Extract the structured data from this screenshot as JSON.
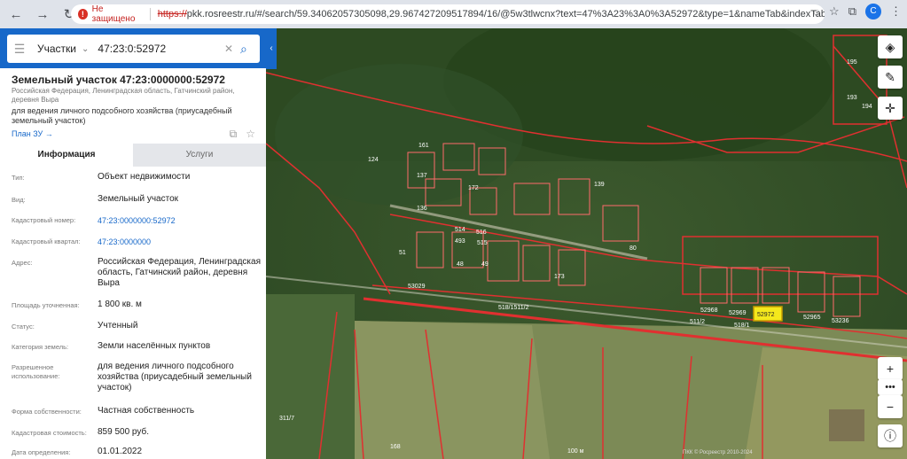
{
  "browser": {
    "security_label": "Не защищено",
    "url_scheme": "https://",
    "url_rest": "pkk.rosreestr.ru/#/search/59.34062057305098,29.967427209517894/16/@5w3tlwcnx?text=47%3A23%3A0%3A52972&type=1&nameTab&indexTab&opened=47%3...",
    "avatar_letter": "C"
  },
  "search": {
    "category": "Участки",
    "query": "47:23:0:52972"
  },
  "parcel": {
    "title": "Земельный участок 47:23:0000000:52972",
    "address_small": "Российская Федерация, Ленинградская область, Гатчинский район, деревня Выра",
    "purpose": "для ведения личного подсобного хозяйства (приусадебный земельный участок)",
    "plan_link": "План ЗУ →"
  },
  "tabs": {
    "info": "Информация",
    "services": "Услуги"
  },
  "props": {
    "type_label": "Тип:",
    "type_value": "Объект недвижимости",
    "kind_label": "Вид:",
    "kind_value": "Земельный участок",
    "cadnum_label": "Кадастровый номер:",
    "cadnum_value": "47:23:0000000:52972",
    "quarter_label": "Кадастровый квартал:",
    "quarter_value": "47:23:0000000",
    "address_label": "Адрес:",
    "address_value": "Российская Федерация, Ленинградская область, Гатчинский район, деревня Выра",
    "area_label": "Площадь уточненная:",
    "area_value": "1 800 кв. м",
    "status_label": "Статус:",
    "status_value": "Учтенный",
    "landcat_label": "Категория земель:",
    "landcat_value": "Земли населённых пунктов",
    "use_label": "Разрешенное использование:",
    "use_value": "для ведения личного подсобного хозяйства (приусадебный земельный участок)",
    "ownership_label": "Форма собственности:",
    "ownership_value": "Частная собственность",
    "cost_label": "Кадастровая стоимость:",
    "cost_value": "859 500 руб.",
    "date_label": "Дата определения:",
    "date_value": "01.01.2022"
  },
  "map": {
    "labels": [
      "52972",
      "52968",
      "52969",
      "52965",
      "53236",
      "518/1",
      "511/2",
      "518/1511/2",
      "53029",
      "311/7",
      "168",
      "124",
      "161",
      "172",
      "173",
      "51",
      "48",
      "49",
      "136",
      "137",
      "139",
      "493",
      "516",
      "515",
      "514",
      "80",
      "195",
      "193",
      "194"
    ],
    "scale_label": "100 м",
    "copyright": "ПКК © Росреестр 2010-2024"
  },
  "colors": {
    "accent": "#1768c9",
    "highlight": "#f4e81c",
    "boundary": "#e03030"
  }
}
